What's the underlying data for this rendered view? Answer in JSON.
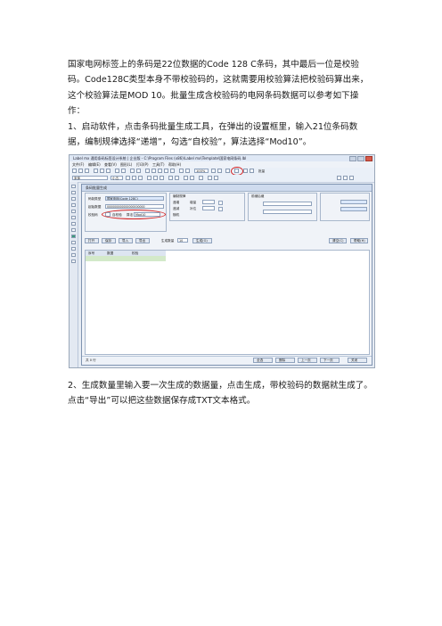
{
  "document": {
    "paragraphs": [
      "国家电网标签上的条码是22位数据的Code 128 C条码，其中最后一位是校验码。Code128C类型本身不带校验码的，这就需要用校验算法把校验码算出来，这个校验算法是MOD 10。批量生成含校验码的电网条码数据可以参考如下操作：",
      "1、启动软件，点击条码批量生成工具，在弹出的设置框里，输入21位条码数据，编制规律选择“递增”，勾选“自校验”，算法选择“Mod10”。",
      "2、生成数量里输入要一次生成的数据量，点击生成，带校验码的数据就生成了。点击“导出”可以把这些数据保存成TXT文本格式。"
    ]
  },
  "screenshot": {
    "title": "Label mx 通用条码标签设计系统 | 企业版 - C:\\Program Files (x86)\\Label mx\\Template\\国家电网条码.lbl",
    "menu": [
      "文件(F)",
      "编辑(E)",
      "查看(V)",
      "图形(L)",
      "打印(P)",
      "工具(T)",
      "帮助(H)"
    ],
    "toolbar": {
      "zoom": "100%",
      "font": "宋体",
      "font_size": "小五",
      "tool_label": "批量"
    },
    "dialog": {
      "title": "条码批量生成",
      "barcode_type_label": "码制类型",
      "barcode_type_value": "国家电网(Code 128C)",
      "start_data_label": "起始数据",
      "start_data_value": "000000000000000000000",
      "checksum_label": "校验码",
      "self_check_label": "自校验",
      "algo_label": "算法",
      "algo_value": "Mod10",
      "rule_group": "编制规律",
      "rule_options": [
        "递增",
        "递减",
        "随机"
      ],
      "step_label": "增量",
      "fill_label": "补位",
      "prefix_label": "前缀后缀",
      "generate_count_label": "生成数量",
      "generate_count_value": "10",
      "generate_button": "生成(G)",
      "buttons": [
        "打开",
        "保存",
        "导入",
        "导出"
      ],
      "grid_headers": [
        "序号",
        "数据",
        "校验"
      ],
      "right_buttons": [
        "清空(C)",
        "帮助(H)"
      ],
      "status": "共 0 行",
      "bottom_buttons": [
        "全选",
        "删除",
        "上一页",
        "下一页",
        "关闭"
      ]
    }
  },
  "colors": {
    "highlight_circle": "#d42020"
  }
}
